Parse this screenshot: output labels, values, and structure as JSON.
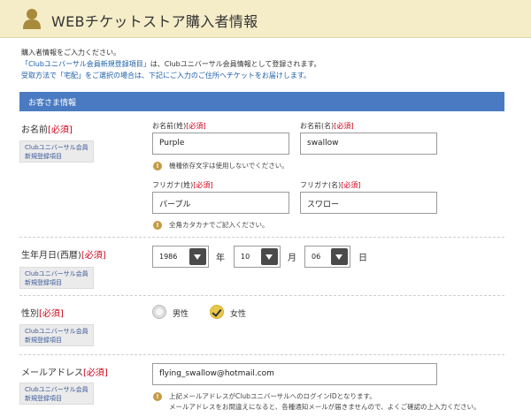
{
  "header": {
    "title": "WEBチケットストア購入者情報"
  },
  "intro": {
    "line1": "購入者情報をご入力ください。",
    "line2_highlight": "「Clubユニバーサル会員新規登録項目」",
    "line2_rest": "は、Clubユニバーサル会員情報として登録されます。",
    "line3": "受取方法で「宅配」をご選択の場合は、下記にご入力のご住所へチケットをお届けします。"
  },
  "section": {
    "title": "お客さま情報"
  },
  "badge": {
    "line1": "Clubユニバーサル会員",
    "line2": "新規登録項目"
  },
  "required": "[必須]",
  "name": {
    "label": "お名前",
    "last_label": "お名前(姓)",
    "first_label": "お名前(名)",
    "last_value": "Purple",
    "first_value": "swallow",
    "note": "機種依存文字は使用しないでください。",
    "kana_last_label": "フリガナ(姓)",
    "kana_first_label": "フリガナ(名)",
    "kana_last_value": "パープル",
    "kana_first_value": "スワロー",
    "kana_note": "全角カタカナでご記入ください。"
  },
  "birthday": {
    "label": "生年月日(西暦)",
    "year": "1986",
    "month": "10",
    "day": "06",
    "year_unit": "年",
    "month_unit": "月",
    "day_unit": "日"
  },
  "gender": {
    "label": "性別",
    "male": "男性",
    "female": "女性",
    "selected": "female"
  },
  "email": {
    "label": "メールアドレス",
    "value": "flying_swallow@hotmail.com",
    "note1": "上記メールアドレスがClubユニバーサルへのログインIDとなります。",
    "note2": "メールアドレスをお間違えになると、各種通知メールが届きませんので、よくご確認の上入力ください。"
  }
}
